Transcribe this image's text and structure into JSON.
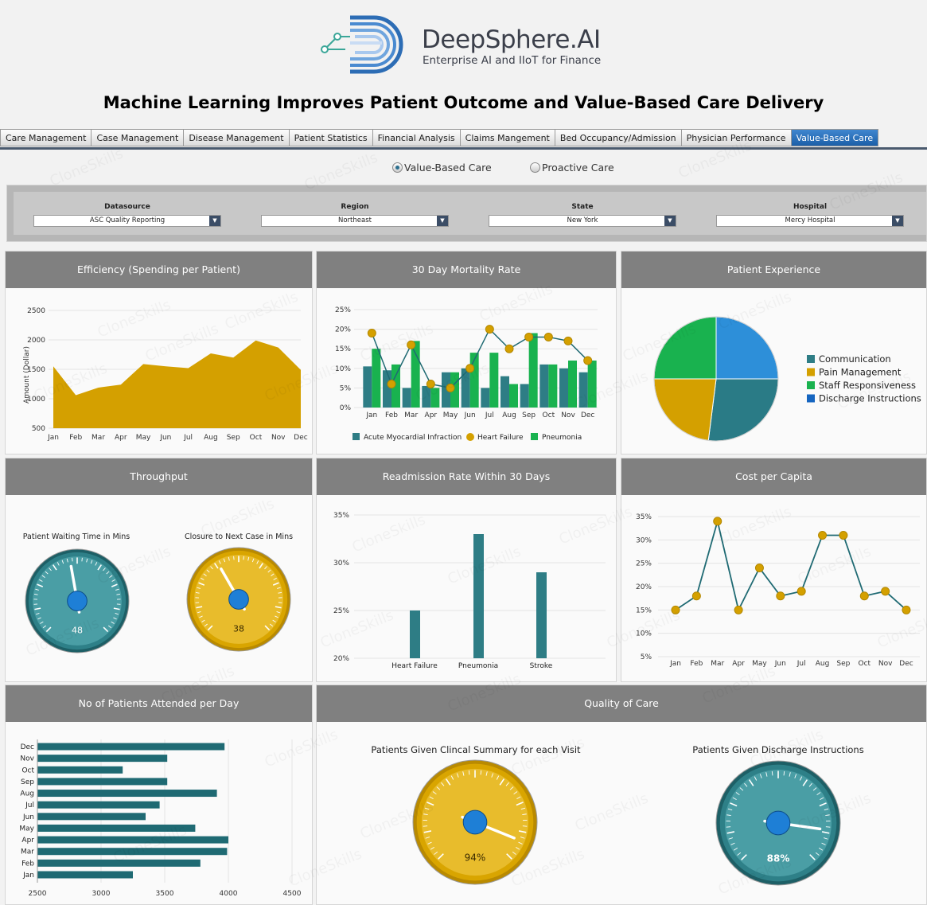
{
  "brand": {
    "name": "DeepSphere.AI",
    "tagline": "Enterprise AI and IIoT for Finance"
  },
  "page_title": "Machine Learning Improves Patient Outcome and Value-Based Care Delivery",
  "tabs": [
    {
      "label": "Care Management",
      "active": false
    },
    {
      "label": "Case Management",
      "active": false
    },
    {
      "label": "Disease Management",
      "active": false
    },
    {
      "label": "Patient Statistics",
      "active": false
    },
    {
      "label": "Financial Analysis",
      "active": false
    },
    {
      "label": "Claims Mangement",
      "active": false
    },
    {
      "label": "Bed Occupancy/Admission",
      "active": false
    },
    {
      "label": "Physician Performance",
      "active": false
    },
    {
      "label": "Value-Based Care",
      "active": true
    }
  ],
  "care_mode": {
    "options": [
      "Value-Based Care",
      "Proactive Care"
    ],
    "selected": "Value-Based Care"
  },
  "filters": [
    {
      "label": "Datasource",
      "value": "ASC Quality Reporting"
    },
    {
      "label": "Region",
      "value": "Northeast"
    },
    {
      "label": "State",
      "value": "New York"
    },
    {
      "label": "Hospital",
      "value": "Mercy Hospital"
    }
  ],
  "watermark_text": "CloneSkills",
  "colors": {
    "gold": "#d4a000",
    "teal": "#2e7d85",
    "green": "#19b24f",
    "blue": "#1565c0",
    "header_gray": "#808080",
    "line_teal": "#1f6a73",
    "active_tab": "#2a70b8"
  },
  "panels": {
    "efficiency": {
      "title": "Efficiency (Spending per Patient)"
    },
    "mortality": {
      "title": "30 Day Mortality Rate"
    },
    "experience": {
      "title": "Patient Experience"
    },
    "throughput": {
      "title": "Throughput"
    },
    "readmission": {
      "title": "Readmission Rate Within 30 Days"
    },
    "cost": {
      "title": "Cost per Capita"
    },
    "attended": {
      "title": "No of Patients Attended per Day"
    },
    "quality": {
      "title": "Quality of Care"
    }
  },
  "chart_data": [
    {
      "id": "efficiency",
      "type": "area",
      "title": "Efficiency (Spending per Patient)",
      "ylabel": "Amount (Dollar)",
      "categories": [
        "Jan",
        "Feb",
        "Mar",
        "Apr",
        "May",
        "Jun",
        "Jul",
        "Aug",
        "Sep",
        "Oct",
        "Nov",
        "Dec"
      ],
      "values": [
        1550,
        1060,
        1190,
        1240,
        1590,
        1550,
        1520,
        1770,
        1700,
        1990,
        1870,
        1490
      ],
      "ylim": [
        500,
        2500
      ],
      "yticks": [
        500,
        1000,
        1500,
        2000,
        2500
      ]
    },
    {
      "id": "mortality",
      "type": "bar",
      "title": "30 Day Mortality Rate",
      "categories": [
        "Jan",
        "Feb",
        "Mar",
        "Apr",
        "May",
        "Jun",
        "Jul",
        "Aug",
        "Sep",
        "Oct",
        "Nov",
        "Dec"
      ],
      "ylim": [
        0,
        25
      ],
      "yticks": [
        "0%",
        "5%",
        "10%",
        "15%",
        "20%",
        "25%"
      ],
      "series": [
        {
          "name": "Acute Myocardial Infraction",
          "kind": "bar",
          "color": "#2e7d85",
          "values": [
            10.5,
            9.5,
            5,
            5.5,
            9,
            10,
            5,
            8,
            6,
            11,
            10,
            9
          ]
        },
        {
          "name": "Heart Failure",
          "kind": "line",
          "color": "#d4a000",
          "values": [
            19,
            6,
            16,
            6,
            5,
            10,
            20,
            15,
            18,
            18,
            17,
            12
          ]
        },
        {
          "name": "Pneumonia",
          "kind": "bar",
          "color": "#19b24f",
          "values": [
            15,
            11,
            17,
            5,
            9,
            14,
            14,
            6,
            19,
            11,
            12,
            12
          ]
        }
      ]
    },
    {
      "id": "experience",
      "type": "pie",
      "title": "Patient Experience",
      "series": [
        {
          "name": "Communication",
          "color": "#2a7b86",
          "value": 27
        },
        {
          "name": "Pain Management",
          "color": "#d4a000",
          "value": 23
        },
        {
          "name": "Staff Responsiveness",
          "color": "#19b24f",
          "value": 25
        },
        {
          "name": "Discharge Instructions",
          "color": "#2d8fd9",
          "value": 25
        }
      ]
    },
    {
      "id": "throughput",
      "type": "gauge",
      "title": "Throughput",
      "gauges": [
        {
          "label": "Patient Waiting Time in Mins",
          "value": 48,
          "color": "teal"
        },
        {
          "label": "Closure to Next Case in Mins",
          "value": 38,
          "color": "gold"
        }
      ]
    },
    {
      "id": "readmission",
      "type": "bar",
      "title": "Readmission Rate Within 30 Days",
      "categories": [
        "Heart Failure",
        "Pneumonia",
        "Stroke"
      ],
      "values": [
        25,
        33,
        29
      ],
      "ylim": [
        20,
        35
      ],
      "yticks": [
        "20%",
        "25%",
        "30%",
        "35%"
      ]
    },
    {
      "id": "cost",
      "type": "line",
      "title": "Cost per Capita",
      "categories": [
        "Jan",
        "Feb",
        "Mar",
        "Apr",
        "May",
        "Jun",
        "Jul",
        "Aug",
        "Sep",
        "Oct",
        "Nov",
        "Dec"
      ],
      "values": [
        15,
        18,
        34,
        15,
        24,
        18,
        19,
        31,
        31,
        18,
        19,
        15
      ],
      "ylim": [
        5,
        35
      ],
      "yticks": [
        "5%",
        "10%",
        "15%",
        "20%",
        "25%",
        "30%",
        "35%"
      ]
    },
    {
      "id": "attended",
      "type": "bar",
      "orientation": "horizontal",
      "title": "No of Patients Attended per Day",
      "categories": [
        "Jan",
        "Feb",
        "Mar",
        "Apr",
        "May",
        "Jun",
        "Jul",
        "Aug",
        "Sep",
        "Oct",
        "Nov",
        "Dec"
      ],
      "values": [
        3250,
        3780,
        3990,
        4000,
        3740,
        3350,
        3460,
        3910,
        3520,
        3170,
        3520,
        3970
      ],
      "xlim": [
        2500,
        4500
      ],
      "xticks": [
        "2500",
        "3000",
        "3500",
        "4000",
        "4500"
      ]
    },
    {
      "id": "quality",
      "type": "gauge",
      "title": "Quality of Care",
      "gauges": [
        {
          "label": "Patients Given Clincal Summary for each Visit",
          "value": "94%",
          "fraction": 0.94,
          "color": "gold"
        },
        {
          "label": "Patients Given Discharge Instructions",
          "value": "88%",
          "fraction": 0.88,
          "color": "teal"
        }
      ]
    }
  ]
}
